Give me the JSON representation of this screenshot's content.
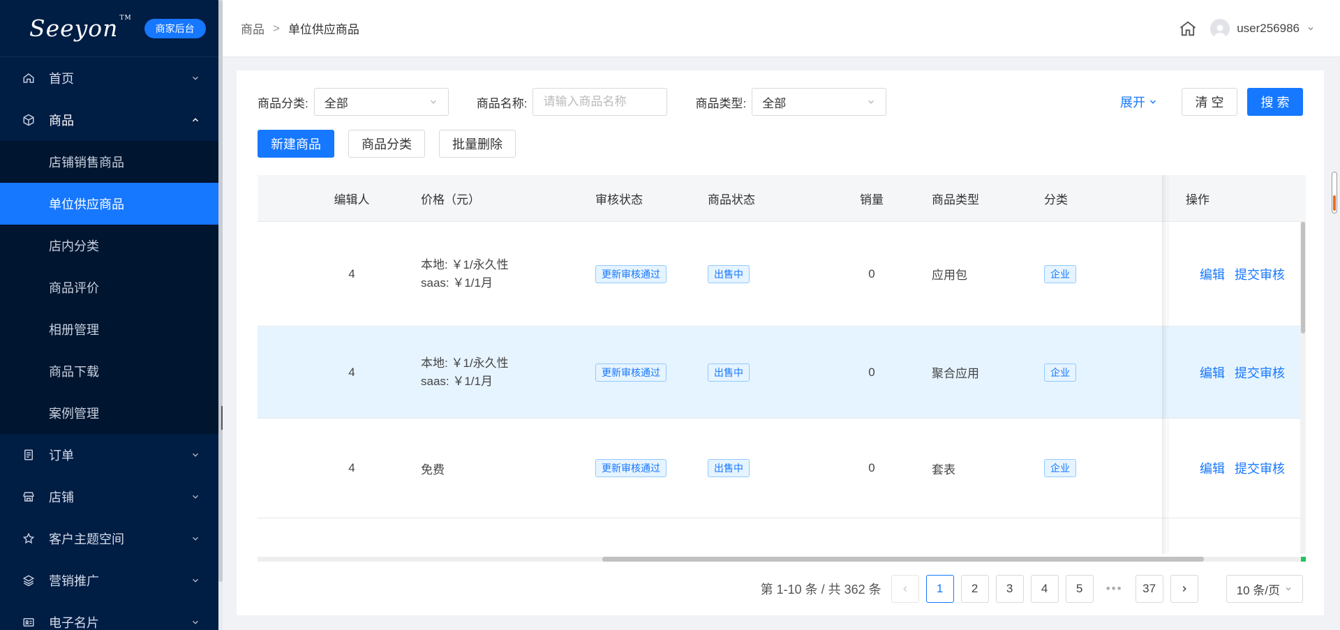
{
  "sidebar": {
    "logo": "Seeyon",
    "logo_tm": "TM",
    "badge": "商家后台",
    "menu": [
      {
        "label": "首页",
        "icon": "home-icon"
      },
      {
        "label": "商品",
        "icon": "cube-icon",
        "open": true
      },
      {
        "label": "订单",
        "icon": "clipboard-icon"
      },
      {
        "label": "店铺",
        "icon": "store-icon"
      },
      {
        "label": "客户主题空间",
        "icon": "star-icon"
      },
      {
        "label": "营销推广",
        "icon": "layers-icon"
      },
      {
        "label": "电子名片",
        "icon": "id-card-icon"
      }
    ],
    "submenu": [
      {
        "label": "店铺销售商品"
      },
      {
        "label": "单位供应商品",
        "active": true
      },
      {
        "label": "店内分类"
      },
      {
        "label": "商品评价"
      },
      {
        "label": "相册管理"
      },
      {
        "label": "商品下载"
      },
      {
        "label": "案例管理"
      }
    ]
  },
  "breadcrumb": {
    "root": "商品",
    "separator": ">",
    "current": "单位供应商品"
  },
  "user": {
    "name": "user256986"
  },
  "filters": {
    "category_label": "商品分类:",
    "category_value": "全部",
    "name_label": "商品名称:",
    "name_placeholder": "请输入商品名称",
    "type_label": "商品类型:",
    "type_value": "全部",
    "expand": "展开",
    "clear": "清 空",
    "search": "搜 索"
  },
  "actions": {
    "new": "新建商品",
    "category": "商品分类",
    "batch_delete": "批量删除"
  },
  "table": {
    "headers": {
      "editor": "编辑人",
      "price": "价格（元）",
      "audit": "审核状态",
      "status": "商品状态",
      "sales": "销量",
      "type": "商品类型",
      "category": "分类",
      "ops": "操作"
    },
    "rows": [
      {
        "editor": "4",
        "price_line1": "本地: ￥1/永久性",
        "price_line2": "saas: ￥1/1月",
        "audit": "更新审核通过",
        "status": "出售中",
        "sales": "0",
        "type": "应用包",
        "category": "企业",
        "edit": "编辑",
        "submit": "提交审核"
      },
      {
        "editor": "4",
        "price_line1": "本地: ￥1/永久性",
        "price_line2": "saas: ￥1/1月",
        "audit": "更新审核通过",
        "status": "出售中",
        "sales": "0",
        "type": "聚合应用",
        "category": "企业",
        "edit": "编辑",
        "submit": "提交审核"
      },
      {
        "editor": "4",
        "price_line1": "免费",
        "price_line2": "",
        "audit": "更新审核通过",
        "status": "出售中",
        "sales": "0",
        "type": "套表",
        "category": "企业",
        "edit": "编辑",
        "submit": "提交审核"
      }
    ]
  },
  "pagination": {
    "total": "第 1-10 条 / 共 362 条",
    "pages": [
      "1",
      "2",
      "3",
      "4",
      "5"
    ],
    "ellipsis": "•••",
    "last": "37",
    "current": "1",
    "page_size": "10 条/页"
  },
  "colors": {
    "primary": "#1677ff",
    "sidebar_bg": "#001d44"
  }
}
